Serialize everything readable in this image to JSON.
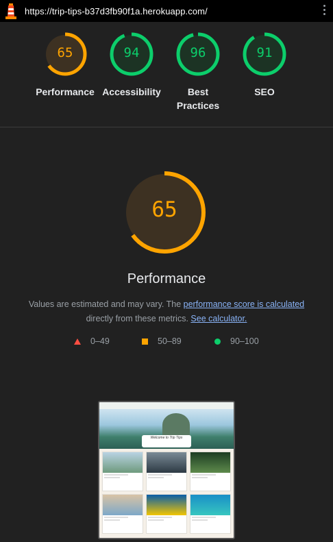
{
  "topbar": {
    "url": "https://trip-tips-b37d3fb90f1a.herokuapp.com/"
  },
  "colors": {
    "fail": "#ff4e42",
    "average": "#ffa400",
    "pass": "#0cce6b",
    "average_bg": "#3d3122",
    "pass_bg": "#1c3324"
  },
  "categories": [
    {
      "label": "Performance",
      "score": "65",
      "value": 0.65,
      "rating": "average"
    },
    {
      "label": "Accessibility",
      "score": "94",
      "value": 0.94,
      "rating": "pass"
    },
    {
      "label": "Best Practices",
      "score": "96",
      "value": 0.96,
      "rating": "pass"
    },
    {
      "label": "SEO",
      "score": "91",
      "value": 0.91,
      "rating": "pass"
    }
  ],
  "main": {
    "score": "65",
    "value": 0.65,
    "title": "Performance",
    "desc_before": "Values are estimated and may vary. The ",
    "desc_link1": "performance score is calculated",
    "desc_middle": "directly from these metrics. ",
    "desc_link2": "See calculator."
  },
  "legend": [
    {
      "range": "0–49",
      "shape": "triangle"
    },
    {
      "range": "50–89",
      "shape": "square"
    },
    {
      "range": "90–100",
      "shape": "circle"
    }
  ],
  "screenshot": {
    "alt": "final-screenshot",
    "hero_text": "Welcome to Trip Tips"
  }
}
